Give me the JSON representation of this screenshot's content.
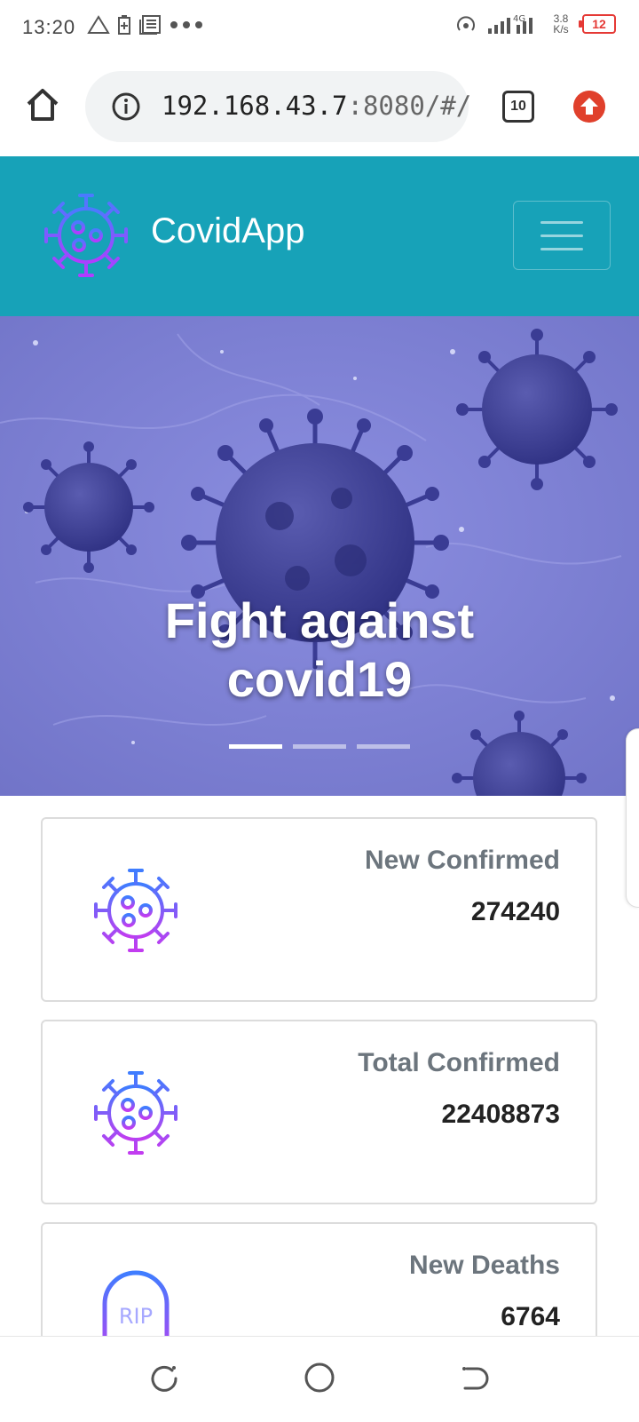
{
  "status_bar": {
    "time": "13:20",
    "network_speed_value": "3.8",
    "network_speed_unit": "K/s",
    "battery": "12",
    "signal_label": "4G"
  },
  "browser": {
    "url_host": "192.168.43.7",
    "url_rest": ":8080/#/",
    "tab_count": "10"
  },
  "navbar": {
    "brand": "CovidApp",
    "bg_color": "#17a2b8"
  },
  "carousel": {
    "caption_line1": "Fight against",
    "caption_line2": "covid19",
    "slide_count": 3,
    "active_slide": 0
  },
  "stats": [
    {
      "label": "New Confirmed",
      "value": "274240",
      "icon": "virus-icon"
    },
    {
      "label": "Total Confirmed",
      "value": "22408873",
      "icon": "virus-icon"
    },
    {
      "label": "New Deaths",
      "value": "6764",
      "icon": "tombstone-rip-icon",
      "icon_text": "RIP"
    }
  ],
  "system_nav": {
    "buttons": [
      "recent-apps",
      "home",
      "back"
    ]
  }
}
